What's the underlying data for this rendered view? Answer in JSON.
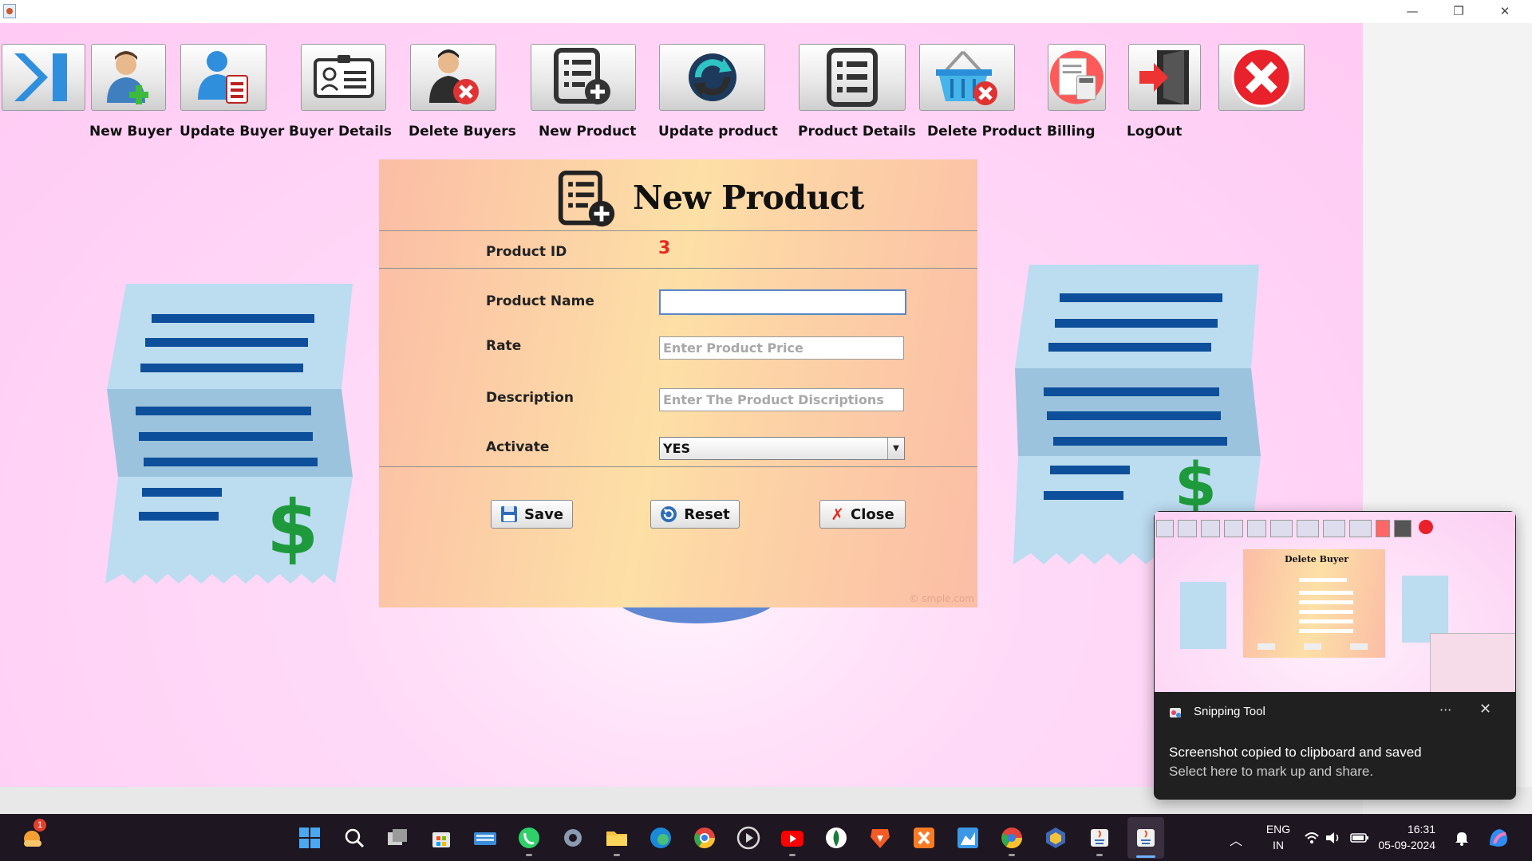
{
  "window": {
    "controls": {
      "minimize": "—",
      "restore": "❐",
      "close": "✕"
    }
  },
  "toolbar": {
    "items": [
      {
        "label": "",
        "icon": "skip-to-end-icon"
      },
      {
        "label": "New Buyer",
        "icon": "add-user-icon"
      },
      {
        "label": "Update Buyer",
        "icon": "update-user-icon"
      },
      {
        "label": "Buyer Details",
        "icon": "id-card-icon"
      },
      {
        "label": "Delete Buyers",
        "icon": "delete-user-icon"
      },
      {
        "label": "New Product",
        "icon": "add-list-icon"
      },
      {
        "label": "Update product",
        "icon": "refresh-icon"
      },
      {
        "label": "Product Details",
        "icon": "list-icon"
      },
      {
        "label": "Delete Product",
        "icon": "delete-basket-icon"
      },
      {
        "label": "Billing",
        "icon": "billing-icon"
      },
      {
        "label": "LogOut",
        "icon": "logout-door-icon"
      },
      {
        "label": "",
        "icon": "exit-icon"
      }
    ]
  },
  "form": {
    "title": "New Product",
    "product_id_label": "Product ID",
    "product_id_value": "3",
    "product_name_label": "Product Name",
    "product_name_value": "",
    "rate_label": "Rate",
    "rate_placeholder": "Enter Product Price",
    "description_label": "Description",
    "description_placeholder": "Enter The Product Discriptions",
    "activate_label": "Activate",
    "activate_value": "YES",
    "save_label": "Save",
    "reset_label": "Reset",
    "close_label": "Close",
    "watermark": "© smple.com"
  },
  "notification": {
    "app": "Snipping Tool",
    "message": "Screenshot copied to clipboard and saved",
    "subtext": "Select here to mark up and share.",
    "more": "···",
    "close": "✕",
    "thumbnail_title": "Delete Buyer"
  },
  "taskbar": {
    "weather_badge": "1",
    "lang_line1": "ENG",
    "lang_line2": "IN",
    "time": "16:31",
    "date": "05-09-2024"
  },
  "colors": {
    "background": "#ffcaf4",
    "panel_start": "#fbbda6",
    "panel_mid": "#fde0a6",
    "product_id": "#e32b20",
    "receipt": "#bcdcf0",
    "receipt_lines": "#0d4f9a",
    "dollar": "#1e9a3c"
  }
}
